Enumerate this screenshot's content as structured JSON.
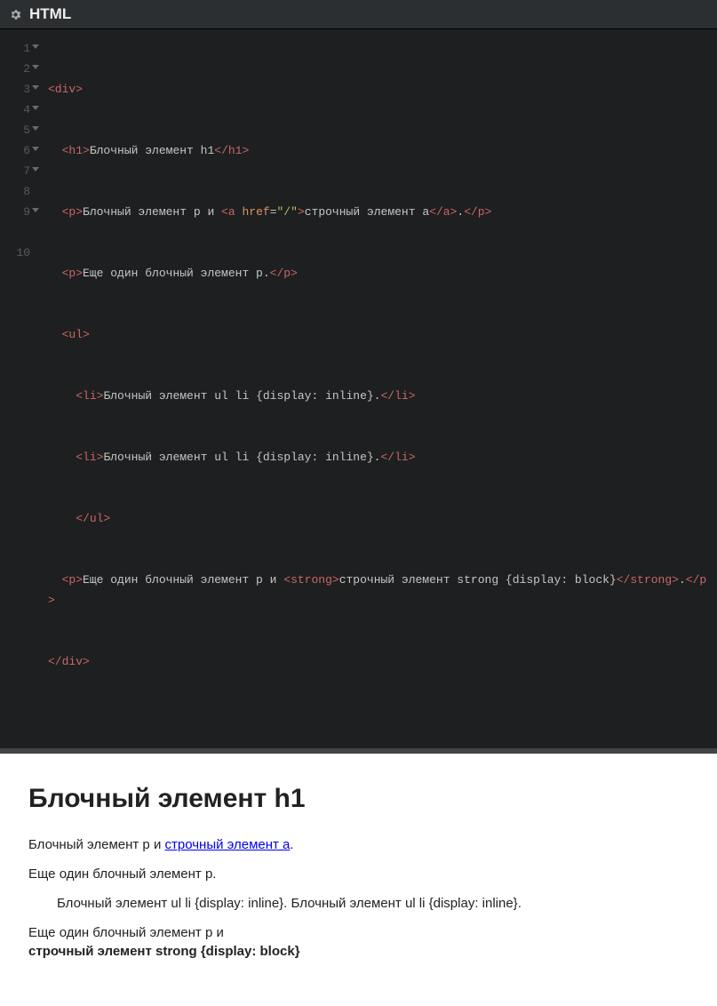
{
  "header": {
    "title": "HTML",
    "gear_icon": "gear"
  },
  "editor": {
    "lines": {
      "l1a": "<div>",
      "l2a": "  ",
      "l2b": "<h1>",
      "l2c": "Блочный элемент h1",
      "l2d": "</h1>",
      "l3a": "  ",
      "l3b": "<p>",
      "l3c": "Блочный элемент p и ",
      "l3d": "<a",
      "l3e": " ",
      "l3f": "href",
      "l3g": "=",
      "l3h": "\"/\"",
      "l3i": ">",
      "l3j": "строчный элемент a",
      "l3k": "</a>",
      "l3l": ".",
      "l3m": "</p>",
      "l4a": "  ",
      "l4b": "<p>",
      "l4c": "Еще один блочный элемент p.",
      "l4d": "</p>",
      "l5a": "  ",
      "l5b": "<ul>",
      "l6a": "    ",
      "l6b": "<li>",
      "l6c": "Блочный элемент ul li {display: inline}.",
      "l6d": "</li>",
      "l7a": "    ",
      "l7b": "<li>",
      "l7c": "Блочный элемент ul li {display: inline}.",
      "l7d": "</li>",
      "l8a": "    ",
      "l8b": "</ul>",
      "l9a": "  ",
      "l9b": "<p>",
      "l9c": "Еще один блочный элемент p и ",
      "l9d": "<strong>",
      "l9e": "строчный элемент strong {display: block}",
      "l9f": "</strong>",
      "l9g": ".",
      "l9h": "</p>",
      "l10a": "</div>"
    },
    "numbers": [
      "1",
      "2",
      "3",
      "4",
      "5",
      "6",
      "7",
      "8",
      "9",
      "",
      "10"
    ]
  },
  "preview": {
    "h1": "Блочный элемент h1",
    "p1_before": "Блочный элемент p и ",
    "p1_link": "строчный элемент a",
    "p1_after": ".",
    "p2": "Еще один блочный элемент p.",
    "li1": "Блочный элемент ul li {display: inline}. ",
    "li2": "Блочный элемент ul li {display: inline}.",
    "p3_before": "Еще один блочный элемент p и ",
    "p3_strong": "строчный элемент strong {display: block}"
  }
}
